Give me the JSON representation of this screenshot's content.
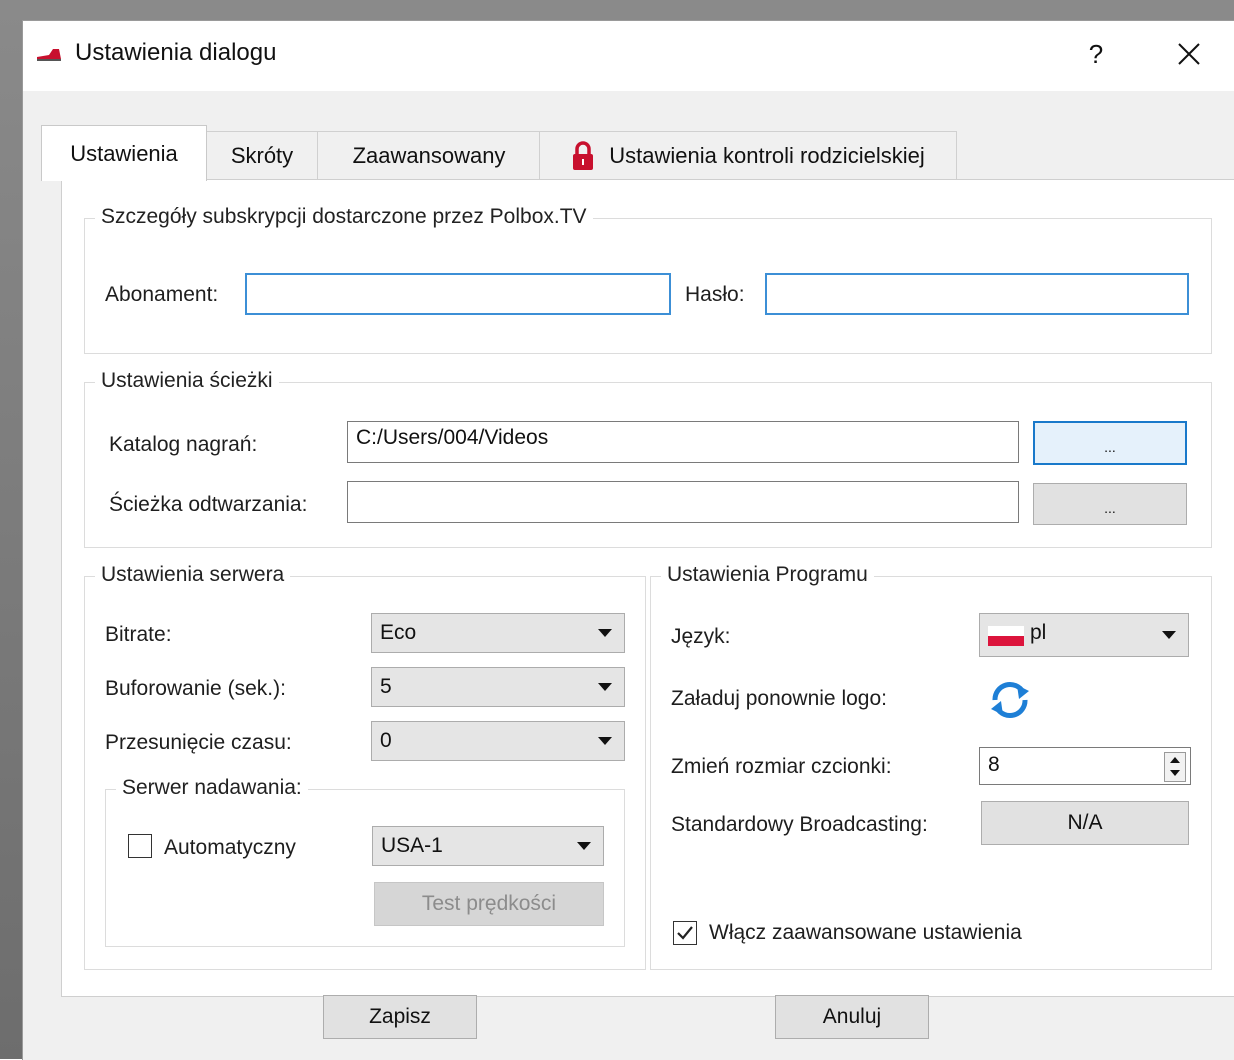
{
  "window": {
    "title": "Ustawienia dialogu",
    "help_label": "?",
    "close_icon": "close-icon",
    "app_icon": "polbox-logo-icon"
  },
  "tabs": [
    {
      "label": "Ustawienia",
      "active": true
    },
    {
      "label": "Skróty"
    },
    {
      "label": "Zaawansowany"
    },
    {
      "label": "Ustawienia kontroli rodzicielskiej",
      "icon": "lock-icon"
    }
  ],
  "subscription": {
    "title": "Szczegóły subskrypcji dostarczone przez Polbox.TV",
    "abonament_label": "Abonament:",
    "abonament_value": "",
    "haslo_label": "Hasło:",
    "haslo_value": ""
  },
  "paths": {
    "title": "Ustawienia ścieżki",
    "recordings_label": "Katalog nagrań:",
    "recordings_value": "C:/Users/004/Videos",
    "playback_label": "Ścieżka odtwarzania:",
    "playback_value": "",
    "browse_label": "..."
  },
  "server": {
    "title": "Ustawienia serwera",
    "bitrate_label": "Bitrate:",
    "bitrate_value": "Eco",
    "buffer_label": "Buforowanie (sek.):",
    "buffer_value": "5",
    "timeshift_label": "Przesunięcie czasu:",
    "timeshift_value": "0",
    "broadcast": {
      "title": "Serwer nadawania:",
      "auto_label": "Automatyczny",
      "auto_checked": false,
      "server_value": "USA-1",
      "speed_test_label": "Test prędkości"
    }
  },
  "program": {
    "title": "Ustawienia Programu",
    "language_label": "Język:",
    "language_value": "pl",
    "reload_logo_label": "Załaduj ponownie logo:",
    "font_size_label": "Zmień rozmiar czcionki:",
    "font_size_value": "8",
    "broadcasting_label": "Standardowy Broadcasting:",
    "broadcasting_value": "N/A",
    "advanced_label": "Włącz zaawansowane ustawienia",
    "advanced_checked": true
  },
  "footer": {
    "save_label": "Zapisz",
    "cancel_label": "Anuluj"
  },
  "colors": {
    "accent": "#1979ca",
    "focus_border": "#3c8fd6",
    "flag_red": "#dc143c",
    "reload_icon": "#1e7fd6"
  }
}
